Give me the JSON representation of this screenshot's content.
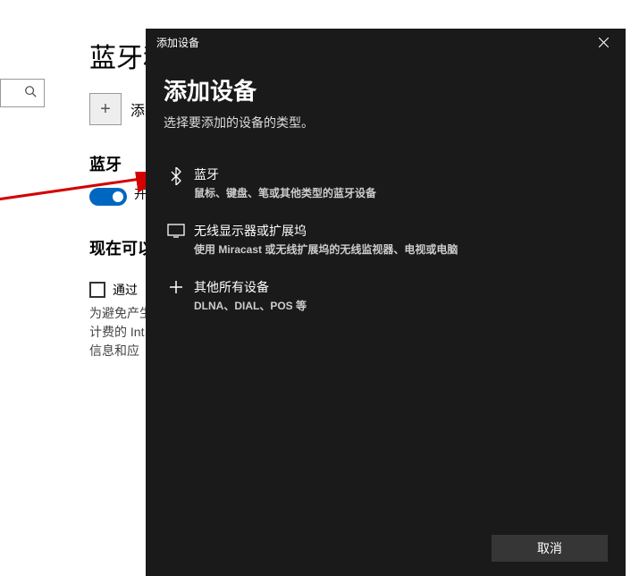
{
  "page": {
    "title": "蓝牙和",
    "add_btn_label": "添",
    "section_bluetooth": "蓝牙",
    "toggle_label": "开",
    "now_heading": "现在可以",
    "checkbox_label": "通过",
    "metered_text_1": "为避免产生",
    "metered_text_2": "计费的 Int",
    "metered_text_3": "信息和应"
  },
  "modal": {
    "titlebar": "添加设备",
    "heading": "添加设备",
    "subtitle": "选择要添加的设备的类型。",
    "options": [
      {
        "title": "蓝牙",
        "desc": "鼠标、键盘、笔或其他类型的蓝牙设备"
      },
      {
        "title": "无线显示器或扩展坞",
        "desc": "使用 Miracast 或无线扩展坞的无线监视器、电视或电脑"
      },
      {
        "title": "其他所有设备",
        "desc": "DLNA、DIAL、POS 等"
      }
    ],
    "cancel": "取消"
  }
}
